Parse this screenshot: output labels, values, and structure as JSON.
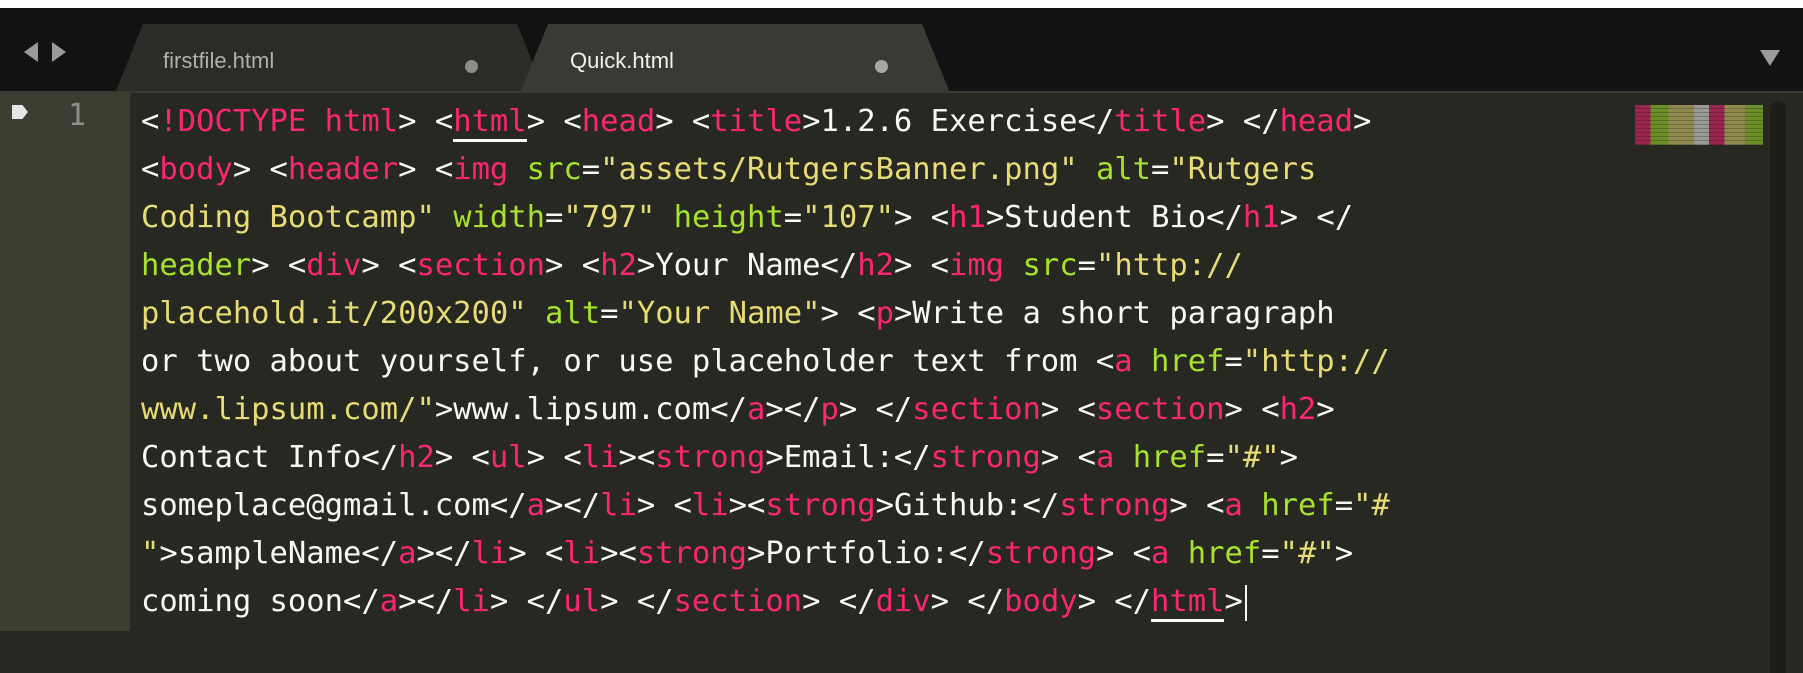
{
  "tabs": [
    {
      "label": "firstfile.html",
      "active": false
    },
    {
      "label": "Quick.html",
      "active": true
    }
  ],
  "editor": {
    "line_number": "1",
    "lines": [
      "<!DOCTYPE html> <html> <head> <title>1.2.6 Exercise</title> </head>",
      "<body> <header> <img src=\"assets/RutgersBanner.png\" alt=\"Rutgers",
      "Coding Bootcamp\" width=\"797\" height=\"107\"> <h1>Student Bio</h1> </",
      "header> <div> <section> <h2>Your Name</h2> <img src=\"http://",
      "placehold.it/200x200\" alt=\"Your Name\"> <p>Write a short paragraph",
      "or two about yourself, or use placeholder text from <a href=\"http://",
      "www.lipsum.com/\">www.lipsum.com</a></p> </section> <section> <h2>",
      "Contact Info</h2> <ul> <li><strong>Email:</strong> <a href=\"#\">",
      "someplace@gmail.com</a></li> <li><strong>Github:</strong> <a href=\"#",
      "\">sampleName</a></li> <li><strong>Portfolio:</strong> <a href=\"#\">",
      "coming soon</a></li> </ul> </section> </div> </body> </html>"
    ]
  },
  "theme": {
    "background": "#272822",
    "tag": "#f92672",
    "attribute": "#a6e22e",
    "string": "#e6db74",
    "text": "#f8f8f2"
  },
  "icons": {
    "nav_back": "left-arrow-icon",
    "nav_forward": "right-arrow-icon",
    "bookmark": "bookmark-icon",
    "dropdown": "chevron-down-icon",
    "tab_dirty": "dot-icon"
  }
}
